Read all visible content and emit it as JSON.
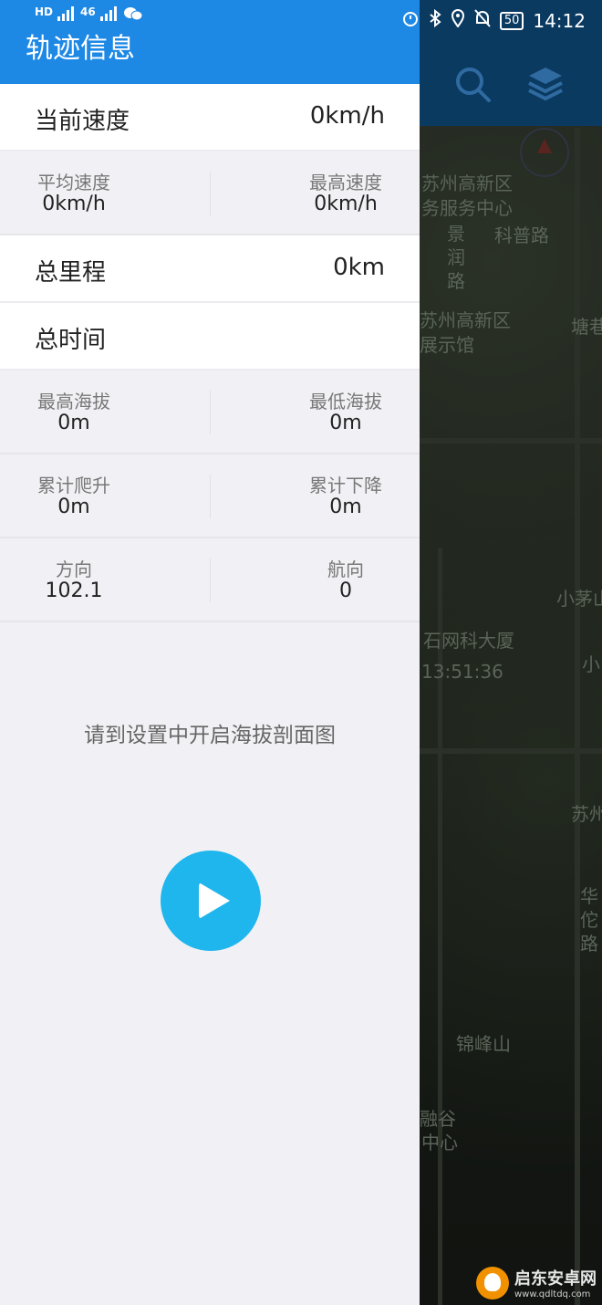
{
  "status_bar": {
    "left_indicators": [
      "HD",
      "46",
      "46"
    ],
    "battery": "50",
    "time": "14:12"
  },
  "drawer": {
    "title": "轨迹信息",
    "current_speed": {
      "label": "当前速度",
      "value": "0km/h"
    },
    "avg_speed": {
      "label": "平均速度",
      "value": "0km/h"
    },
    "max_speed": {
      "label": "最高速度",
      "value": "0km/h"
    },
    "total_distance": {
      "label": "总里程",
      "value": "0km"
    },
    "total_time": {
      "label": "总时间",
      "value": ""
    },
    "max_altitude": {
      "label": "最高海拔",
      "value": "0m"
    },
    "min_altitude": {
      "label": "最低海拔",
      "value": "0m"
    },
    "total_climb": {
      "label": "累计爬升",
      "value": "0m"
    },
    "total_descent": {
      "label": "累计下降",
      "value": "0m"
    },
    "direction": {
      "label": "方向",
      "value": "102.1"
    },
    "heading": {
      "label": "航向",
      "value": "0"
    },
    "notice": "请到设置中开启海拔剖面图"
  },
  "map": {
    "labels": [
      "苏州高新区",
      "务服务中心",
      "科普路",
      "景",
      "润",
      "路",
      "苏州高新区",
      "展示馆",
      "塘巷",
      "小茅山",
      "石网科大厦",
      "13:51:36",
      "小",
      "苏州",
      "华",
      "佗",
      "路",
      "锦峰山",
      "融谷",
      "中心"
    ]
  },
  "watermark": {
    "name": "启东安卓网",
    "url": "www.qdltdq.com"
  },
  "icons": {
    "search": "search-icon",
    "layers": "layers-icon",
    "play": "play-icon"
  }
}
